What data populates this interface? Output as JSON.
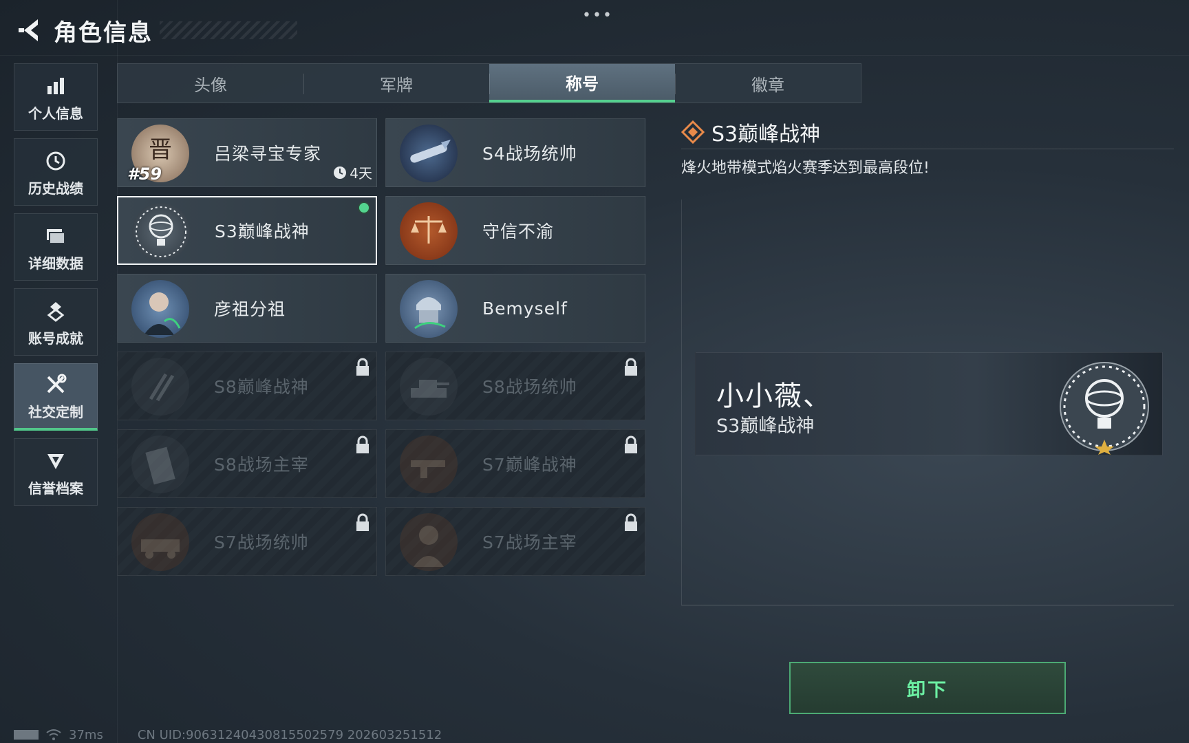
{
  "header": {
    "title": "角色信息",
    "back_icon": "chevron-left-icon",
    "more_label": "•••"
  },
  "sidebar": {
    "items": [
      {
        "label": "个人信息",
        "icon": "bar-chart-icon",
        "active": false
      },
      {
        "label": "历史战绩",
        "icon": "history-clock-icon",
        "active": false
      },
      {
        "label": "详细数据",
        "icon": "folder-icon",
        "active": false
      },
      {
        "label": "账号成就",
        "icon": "medal-icon",
        "active": false
      },
      {
        "label": "社交定制",
        "icon": "tools-icon",
        "active": true
      },
      {
        "label": "信誉档案",
        "icon": "shield-badge-icon",
        "active": false
      }
    ]
  },
  "tabs": [
    {
      "label": "头像",
      "active": false
    },
    {
      "label": "军牌",
      "active": false
    },
    {
      "label": "称号",
      "active": true
    },
    {
      "label": "徽章",
      "active": false
    }
  ],
  "titles": [
    {
      "name": "吕梁寻宝专家",
      "badge": "treasure",
      "number": "#59",
      "expiry": "4天",
      "locked": false,
      "selected": false,
      "equipped": false
    },
    {
      "name": "S4战场统帅",
      "badge": "missile",
      "locked": false,
      "selected": false,
      "equipped": false
    },
    {
      "name": "S3巅峰战神",
      "badge": "armillary",
      "locked": false,
      "selected": true,
      "equipped": true
    },
    {
      "name": "守信不渝",
      "badge": "scales",
      "locked": false,
      "selected": false,
      "equipped": false
    },
    {
      "name": "彦祖分祖",
      "badge": "portrait",
      "locked": false,
      "selected": false,
      "equipped": false
    },
    {
      "name": "Bemyself",
      "badge": "soldier",
      "locked": false,
      "selected": false,
      "equipped": false
    },
    {
      "name": "S8巅峰战神",
      "badge": "slashes",
      "locked": true
    },
    {
      "name": "S8战场统帅",
      "badge": "tank",
      "locked": true
    },
    {
      "name": "S8战场主宰",
      "badge": "building",
      "locked": true
    },
    {
      "name": "S7巅峰战神",
      "badge": "gun",
      "locked": true
    },
    {
      "name": "S7战场统帅",
      "badge": "vehicle",
      "locked": true
    },
    {
      "name": "S7战场主宰",
      "badge": "warrior",
      "locked": true
    }
  ],
  "detail": {
    "title": "S3巅峰战神",
    "description": "烽火地带模式焰火赛季达到最高段位!",
    "preview": {
      "player_name": "小小薇、",
      "title": "S3巅峰战神"
    }
  },
  "actions": {
    "unequip_label": "卸下"
  },
  "status": {
    "ping": "37ms",
    "uid": "CN UID:9063124043081​5502579 202603251512"
  },
  "colors": {
    "accent_green": "#55d08f",
    "equipped_dot": "#53d58f"
  }
}
